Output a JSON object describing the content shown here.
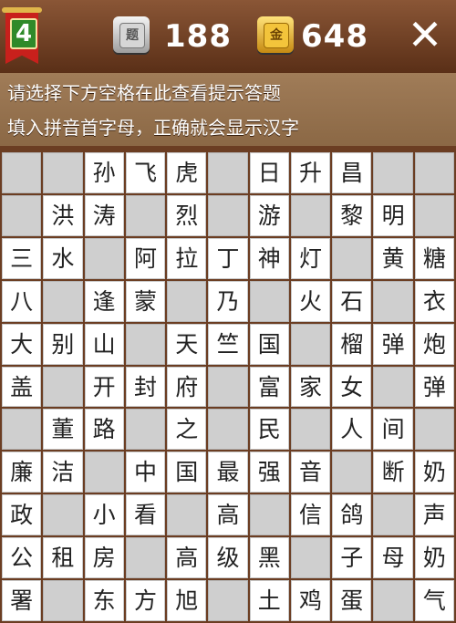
{
  "header": {
    "level": "4",
    "ticket_icon_glyph": "题",
    "ticket_count": "188",
    "gold_icon_glyph": "金",
    "gold_count": "648",
    "close_label": "✕"
  },
  "hint": {
    "line1": "请选择下方空格在此查看提示答题",
    "line2": "填入拼音首字母，正确就会显示汉字"
  },
  "colors": {
    "wood_dark": "#6b3d22",
    "blank_cell": "#cfcfcf",
    "open_cell": "#ffffff",
    "flag_red": "#c8201c",
    "level_green": "#2f8a2a"
  },
  "grid": [
    [
      "",
      "",
      "孙",
      "飞",
      "虎",
      "",
      "日",
      "升",
      "昌",
      "",
      ""
    ],
    [
      "",
      "洪",
      "涛",
      "",
      "烈",
      "",
      "游",
      "",
      "黎",
      "明",
      ""
    ],
    [
      "三",
      "水",
      "",
      "阿",
      "拉",
      "丁",
      "神",
      "灯",
      "",
      "黄",
      "糖"
    ],
    [
      "八",
      "",
      "逢",
      "蒙",
      "",
      "乃",
      "",
      "火",
      "石",
      "",
      "衣"
    ],
    [
      "大",
      "别",
      "山",
      "",
      "天",
      "竺",
      "国",
      "",
      "榴",
      "弹",
      "炮"
    ],
    [
      "盖",
      "",
      "开",
      "封",
      "府",
      "",
      "富",
      "家",
      "女",
      "",
      "弹"
    ],
    [
      "",
      "董",
      "路",
      "",
      "之",
      "",
      "民",
      "",
      "人",
      "间",
      ""
    ],
    [
      "廉",
      "洁",
      "",
      "中",
      "国",
      "最",
      "强",
      "音",
      "",
      "断",
      "奶"
    ],
    [
      "政",
      "",
      "小",
      "看",
      "",
      "高",
      "",
      "信",
      "鸽",
      "",
      "声"
    ],
    [
      "公",
      "租",
      "房",
      "",
      "高",
      "级",
      "黑",
      "",
      "子",
      "母",
      "奶"
    ],
    [
      "署",
      "",
      "东",
      "方",
      "旭",
      "",
      "土",
      "鸡",
      "蛋",
      "",
      "气"
    ]
  ]
}
